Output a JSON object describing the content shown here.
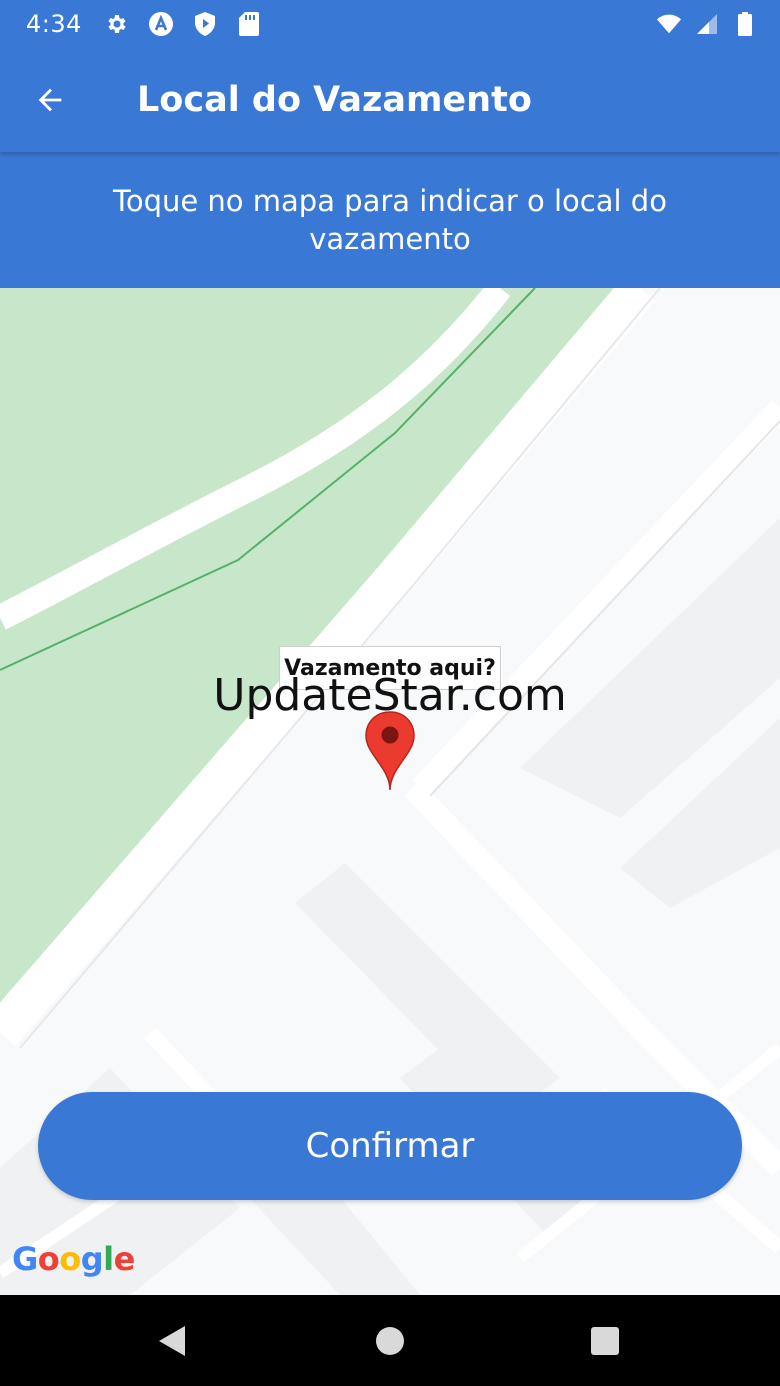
{
  "status_bar": {
    "time": "4:34",
    "left_icons": [
      "gear-icon",
      "app-a-icon",
      "shield-play-icon",
      "sd-card-icon"
    ],
    "right_icons": [
      "wifi-icon",
      "cell-signal-icon",
      "battery-icon"
    ]
  },
  "app_bar": {
    "back_icon": "arrow-left-icon",
    "title": "Local do Vazamento"
  },
  "instruction": {
    "text": "Toque no mapa para indicar o local do vazamento"
  },
  "map": {
    "marker_label": "Vazamento aqui?",
    "watermark": "UpdateStar.com",
    "attribution": "Google",
    "attribution_letters": [
      {
        "char": "G",
        "color": "#4285F4"
      },
      {
        "char": "o",
        "color": "#EA4335"
      },
      {
        "char": "o",
        "color": "#FBBC05"
      },
      {
        "char": "g",
        "color": "#4285F4"
      },
      {
        "char": "l",
        "color": "#34A853"
      },
      {
        "char": "e",
        "color": "#EA4335"
      }
    ]
  },
  "actions": {
    "confirm_label": "Confirmar"
  },
  "nav_bar": {
    "buttons": [
      "back-triangle-icon",
      "home-circle-icon",
      "recents-square-icon"
    ]
  },
  "colors": {
    "primary": "#3a78d6",
    "park_green": "#c8e6c9",
    "marker_red": "#ea3b2e"
  }
}
